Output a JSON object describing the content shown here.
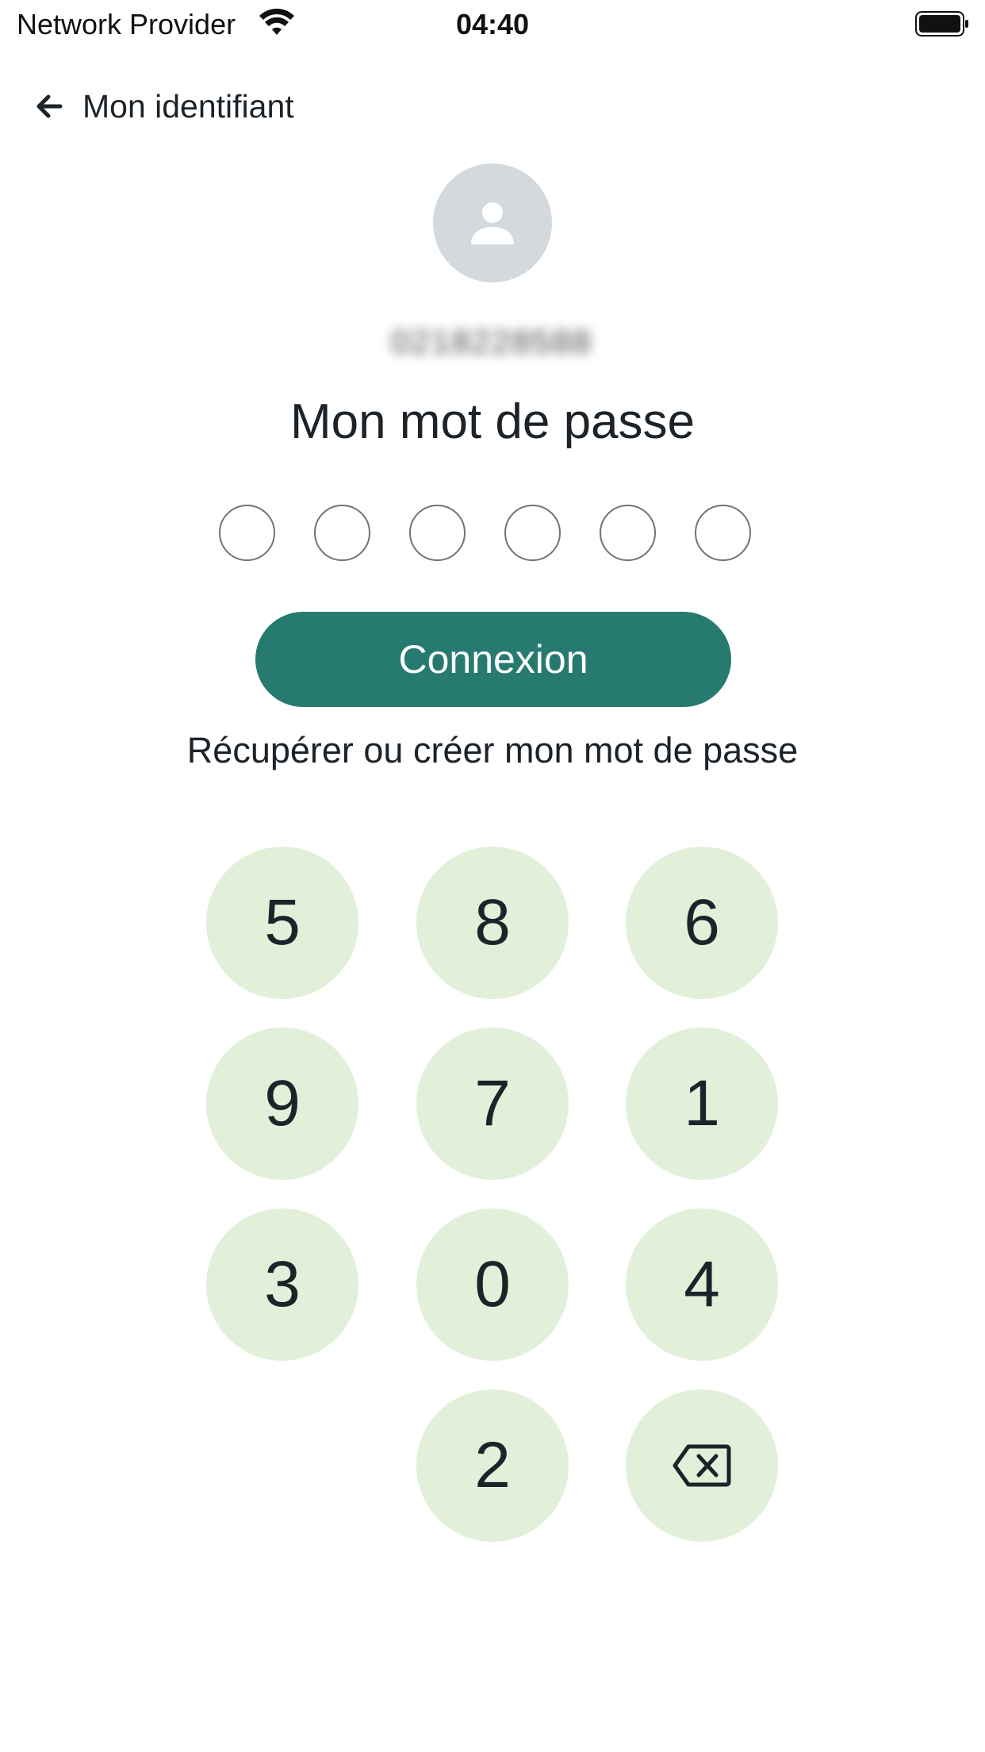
{
  "status_bar": {
    "carrier": "Network Provider",
    "time": "04:40"
  },
  "nav": {
    "back_label": "Mon identifiant",
    "back_icon": "arrow-left-icon"
  },
  "user": {
    "avatar_icon": "person-icon",
    "identifier_masked": "0218228588"
  },
  "title": "Mon mot de passe",
  "pin": {
    "length": 6,
    "filled": 0
  },
  "buttons": {
    "connect": "Connexion",
    "recover": "Récupérer ou créer mon mot de passe"
  },
  "keypad": {
    "keys": [
      "5",
      "8",
      "6",
      "9",
      "7",
      "1",
      "3",
      "0",
      "4",
      "2"
    ],
    "delete_icon": "backspace-icon"
  },
  "colors": {
    "primary": "#277a70",
    "key_background": "#e2f0da",
    "avatar_background": "#d3d9dd"
  }
}
